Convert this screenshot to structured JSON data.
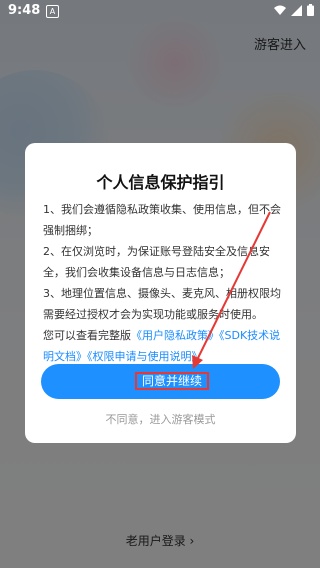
{
  "status_bar": {
    "time": "9:48",
    "notification_glyph": "A"
  },
  "guest_entry_label": "游客进入",
  "old_user_login_label": "老用户登录 ›",
  "dialog": {
    "title": "个人信息保护指引",
    "paragraph1": "1、我们会遵循隐私政策收集、使用信息，但不会强制捆绑；",
    "paragraph2": "2、在仅浏览时，为保证账号登陆安全及信息安全，我们会收集设备信息与日志信息；",
    "paragraph3": "3、地理位置信息、摄像头、麦克风、相册权限均需要经过授权才会为实现功能或服务时使用。",
    "paragraph4_prefix": "您可以查看完整版",
    "link_privacy": "《用户隐私政策》",
    "link_sdk": "《SDK技术说明文档》",
    "link_permission": "《权限申请与使用说明》",
    "agree_label": "同意并继续",
    "decline_label": "不同意，进入游客模式"
  },
  "colors": {
    "accent": "#1e90ff",
    "link": "#1a8cff",
    "highlight_box": "#e53935",
    "annotation_arrow": "#e53935"
  }
}
